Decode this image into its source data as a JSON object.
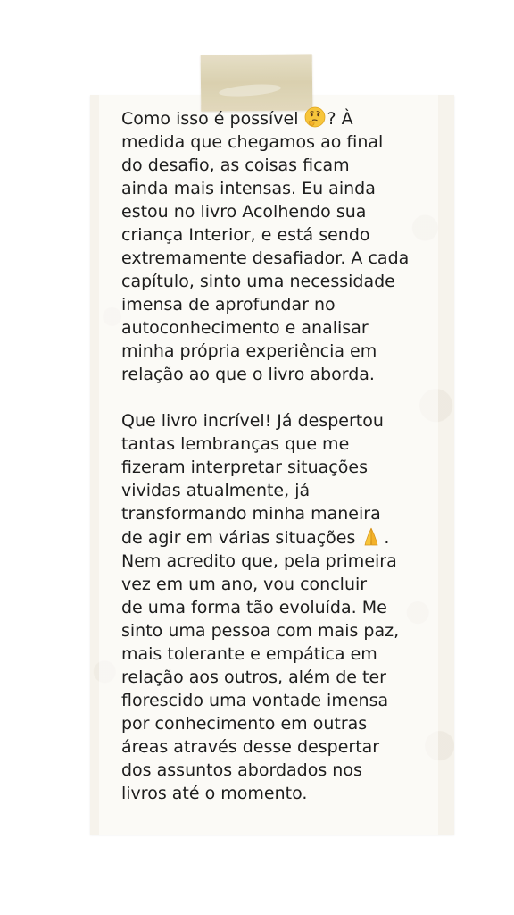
{
  "message": {
    "paragraph_1": {
      "line_1_a": "Como isso é possível",
      "line_1_emoji": "thinking-face-icon",
      "line_1_b": "? À",
      "lines": [
        "medida que chegamos ao final",
        "do desafio, as coisas ficam",
        "ainda mais intensas. Eu ainda",
        "estou no livro Acolhendo sua",
        "criança Interior, e está sendo",
        "extremamente desafiador. A cada",
        "capítulo, sinto uma necessidade",
        "imensa de aprofundar no",
        "autoconhecimento e analisar",
        "minha própria experiência em",
        "relação ao que o livro aborda."
      ]
    },
    "paragraph_2": {
      "lines_before": [
        "Que livro incrível! Já despertou",
        "tantas lembranças que me",
        "fizeram interpretar situações",
        "vividas atualmente, já",
        "transformando minha maneira"
      ],
      "line_emoji_a": "de agir em várias situações",
      "line_emoji_icon": "folded-hands-icon",
      "line_emoji_b": ".",
      "lines_after": [
        "Nem acredito que, pela primeira",
        "vez em um ano, vou concluir",
        "de uma forma tão evoluída. Me",
        "sinto uma pessoa com mais paz,",
        "mais tolerante e empática em",
        "relação aos outros, além de ter",
        "florescido uma vontade imensa",
        "por conhecimento em outras",
        "áreas através desse despertar",
        "dos assuntos abordados nos",
        "livros até o momento."
      ]
    }
  },
  "colors": {
    "text": "#1d1d1d",
    "card_background": "#f6f3ec",
    "tape": "#d7cda9",
    "emoji_yellow": "#f7c53b"
  }
}
